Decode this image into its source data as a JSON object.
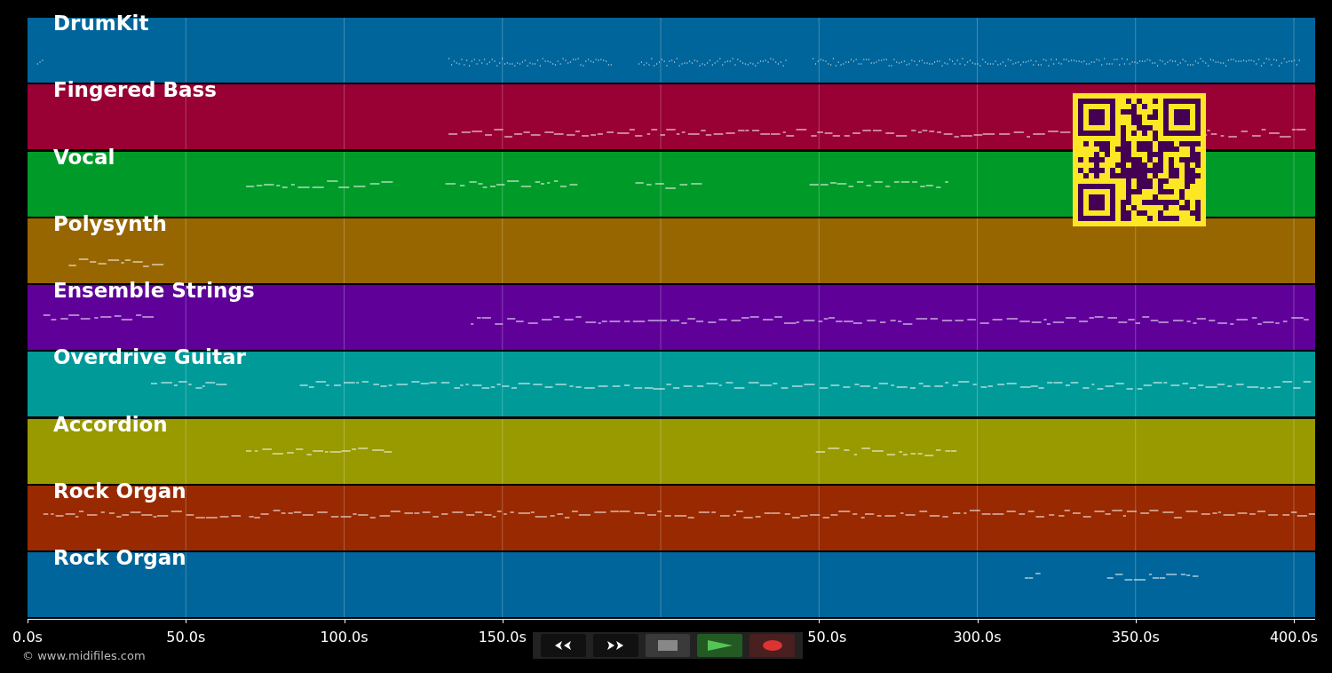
{
  "tracks": [
    {
      "name": "DrumKit",
      "color": "#00659a"
    },
    {
      "name": "Fingered Bass",
      "color": "#990033"
    },
    {
      "name": "Vocal",
      "color": "#009a29"
    },
    {
      "name": "Polysynth",
      "color": "#986600"
    },
    {
      "name": "Ensemble Strings",
      "color": "#5f0099"
    },
    {
      "name": "Overdrive Guitar",
      "color": "#009a99"
    },
    {
      "name": "Accordion",
      "color": "#999900"
    },
    {
      "name": "Rock Organ",
      "color": "#982900"
    },
    {
      "name": "Rock Organ",
      "color": "#00659a"
    }
  ],
  "time_axis": {
    "ticks": [
      "0.0s",
      "50.0s",
      "100.0s",
      "150.0s",
      "50.0s",
      "300.0s",
      "350.0s",
      "400.0s"
    ]
  },
  "transport": [
    {
      "kind": "rewind"
    },
    {
      "kind": "forward"
    },
    {
      "kind": "stop"
    },
    {
      "kind": "play"
    },
    {
      "kind": "record"
    }
  ],
  "copyright": "© www.midifiles.com"
}
